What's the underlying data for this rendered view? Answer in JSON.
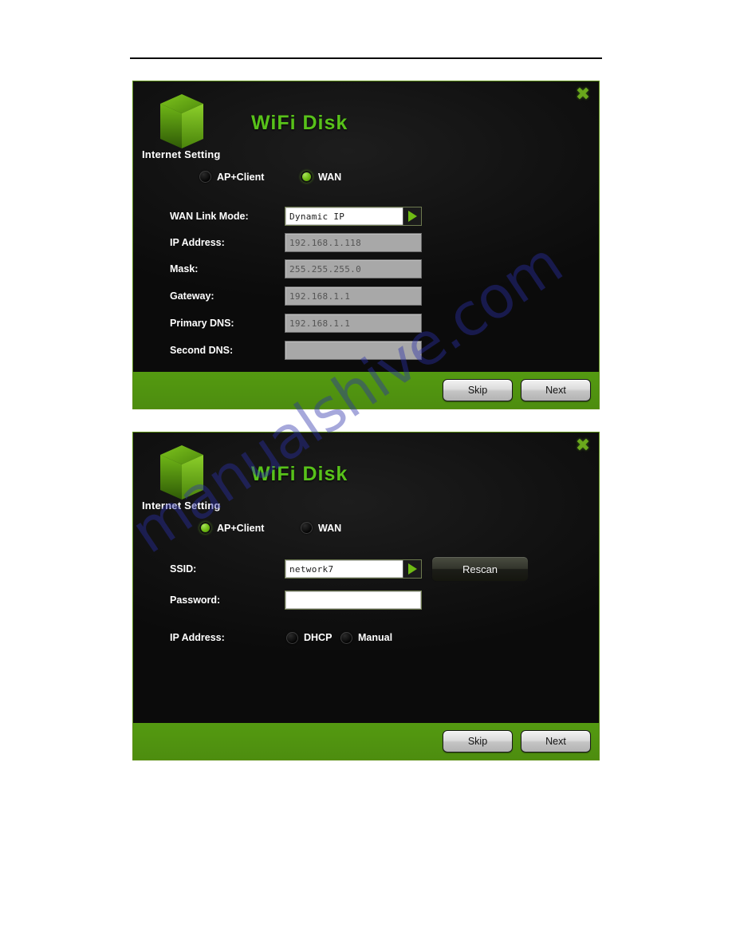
{
  "watermark": {
    "text": "manualshive.com",
    "color": "#2b30aa"
  },
  "brand": {
    "title": "WiFi Disk",
    "section": "Internet Setting",
    "close_icon": "close-icon",
    "logo_icon": "cube-logo-icon",
    "accent_green": "#58c21a",
    "footer_green": "#4f9010"
  },
  "dialog_wan": {
    "title": "WiFi Disk",
    "section": "Internet Setting",
    "close_label": "✖",
    "modes": [
      {
        "label": "AP+Client",
        "selected": false
      },
      {
        "label": "WAN",
        "selected": true
      }
    ],
    "fields": [
      {
        "label": "WAN Link Mode:",
        "value": "Dynamic IP",
        "state": "editable",
        "dropdown": true
      },
      {
        "label": "IP Address:",
        "value": "192.168.1.118",
        "state": "disabled",
        "dropdown": false
      },
      {
        "label": "Mask:",
        "value": "255.255.255.0",
        "state": "disabled",
        "dropdown": false
      },
      {
        "label": "Gateway:",
        "value": "192.168.1.1",
        "state": "disabled",
        "dropdown": false
      },
      {
        "label": "Primary DNS:",
        "value": "192.168.1.1",
        "state": "disabled",
        "dropdown": false
      },
      {
        "label": "Second DNS:",
        "value": "",
        "state": "disabled",
        "dropdown": false
      }
    ],
    "buttons": {
      "skip": "Skip",
      "next": "Next"
    }
  },
  "dialog_ap": {
    "title": "WiFi Disk",
    "section": "Internet Setting",
    "close_label": "✖",
    "modes": [
      {
        "label": "AP+Client",
        "selected": true
      },
      {
        "label": "WAN",
        "selected": false
      }
    ],
    "ssid": {
      "label": "SSID:",
      "value": "network7"
    },
    "password": {
      "label": "Password:",
      "value": ""
    },
    "rescan_label": "Rescan",
    "ip_address": {
      "label": "IP Address:",
      "options": [
        {
          "label": "DHCP",
          "selected": false
        },
        {
          "label": "Manual",
          "selected": false
        }
      ]
    },
    "buttons": {
      "skip": "Skip",
      "next": "Next"
    }
  }
}
